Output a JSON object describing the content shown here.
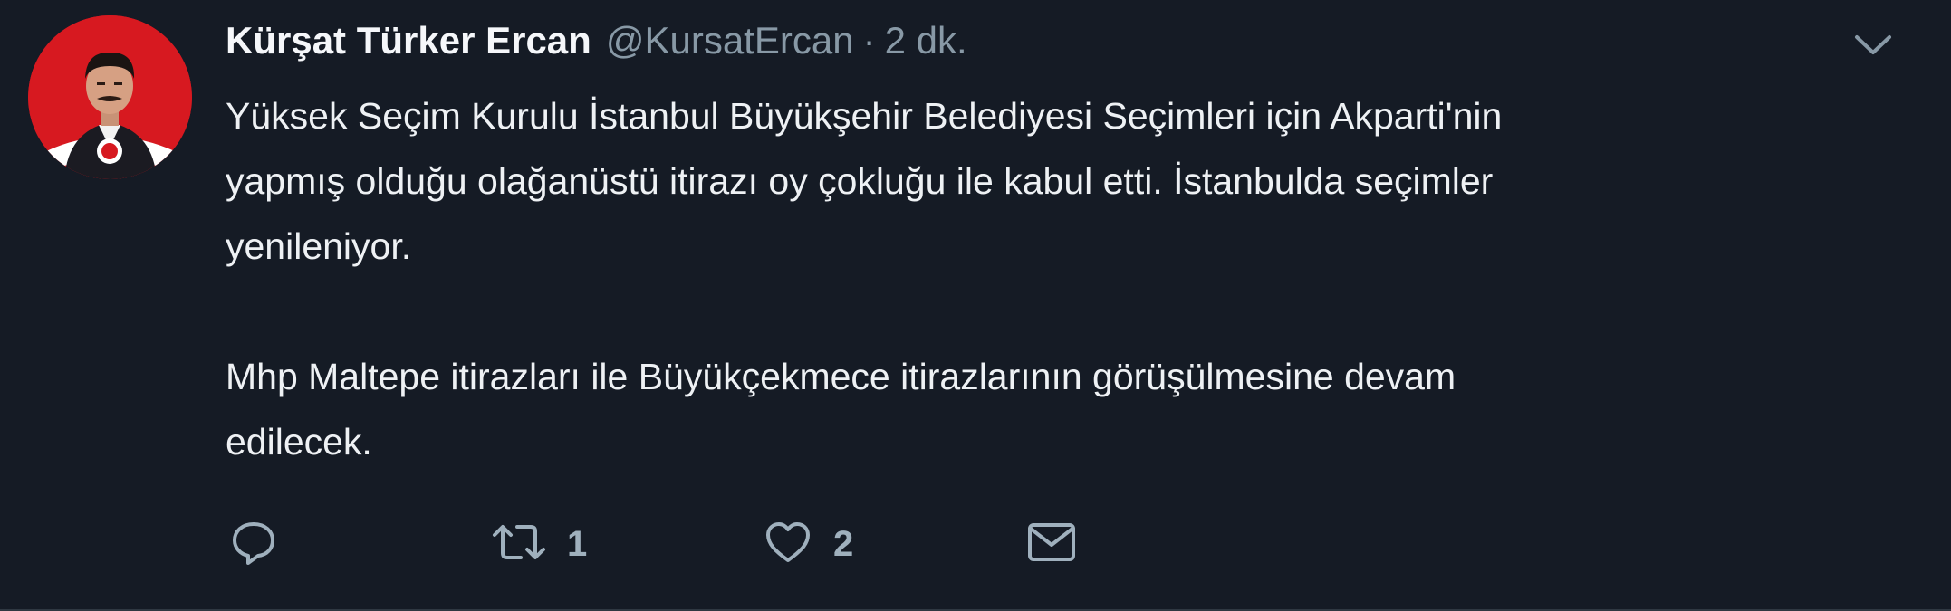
{
  "tweet": {
    "author_name": "Kürşat Türker Ercan",
    "author_handle": "@KursatErcan",
    "separator": "·",
    "time": "2 dk.",
    "paragraphs": [
      "Yüksek Seçim Kurulu İstanbul Büyükşehir Belediyesi Seçimleri için Akparti'nin",
      "yapmış olduğu olağanüstü itirazı oy çokluğu ile kabul etti. İstanbulda seçimler",
      "yenileniyor.",
      "Mhp Maltepe itirazları ile Büyükçekmece itirazlarının görüşülmesine devam",
      "edilecek."
    ],
    "actions": {
      "reply_icon": "reply-icon",
      "retweet_icon": "retweet-icon",
      "retweet_count": "1",
      "like_icon": "heart-icon",
      "like_count": "2",
      "dm_icon": "envelope-icon"
    },
    "menu_icon": "chevron-down-icon"
  },
  "colors": {
    "background": "#151b25",
    "text": "#eef1f4",
    "muted": "#8899a6",
    "avatar_bg": "#d71920"
  }
}
